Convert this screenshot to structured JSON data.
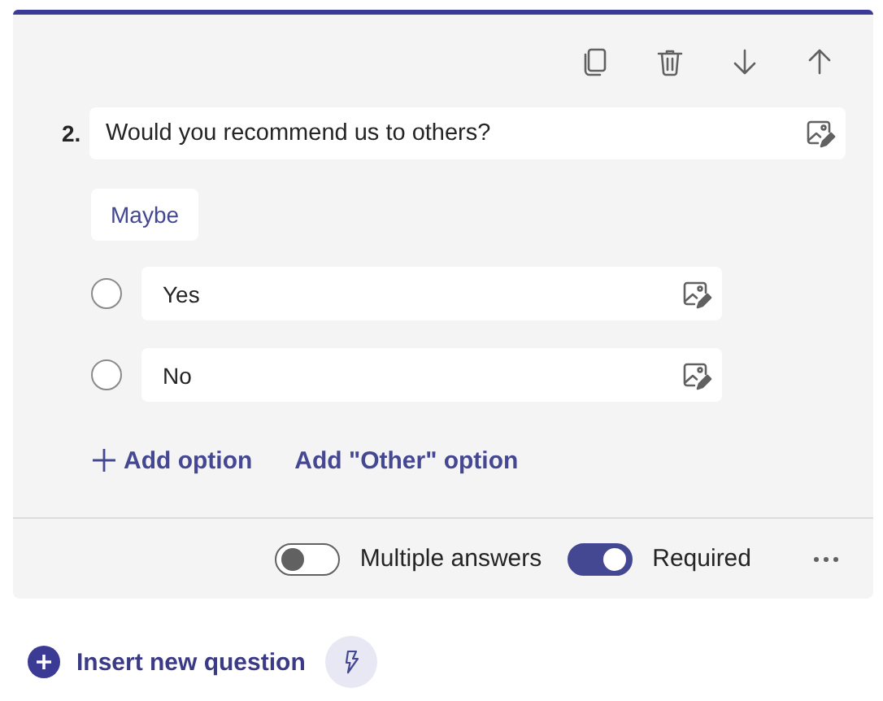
{
  "question": {
    "number": "2.",
    "text": "Would you recommend us to others?"
  },
  "suggestion": "Maybe",
  "options": [
    {
      "text": "Yes",
      "selected": false
    },
    {
      "text": "No",
      "selected": false
    }
  ],
  "add_option": "Add option",
  "add_other_option": "Add \"Other\" option",
  "settings": [
    {
      "label": "Multiple answers",
      "on": false
    },
    {
      "label": "Required",
      "on": true
    }
  ],
  "insert_button": "Insert new question"
}
